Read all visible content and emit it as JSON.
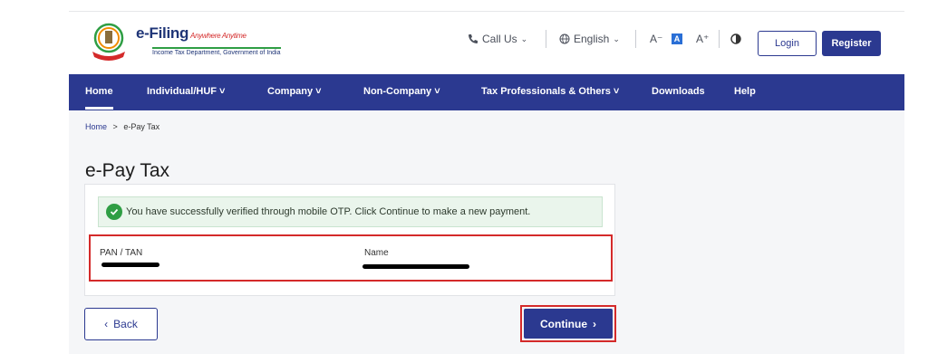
{
  "header": {
    "logo_title": "e-Filing",
    "logo_tagline": "Anywhere Anytime",
    "logo_subtitle": "Income Tax Department, Government of India",
    "call_us": "Call Us",
    "language": "English",
    "font_decrease": "A⁻",
    "font_default": "A",
    "font_increase": "A⁺",
    "login_label": "Login",
    "register_label": "Register"
  },
  "nav": {
    "items": [
      {
        "label": "Home"
      },
      {
        "label": "Individual/HUF ˅"
      },
      {
        "label": "Company ˅"
      },
      {
        "label": "Non-Company ˅"
      },
      {
        "label": "Tax Professionals & Others ˅"
      },
      {
        "label": "Downloads"
      },
      {
        "label": "Help"
      }
    ]
  },
  "breadcrumb": {
    "home": "Home",
    "separator": ">",
    "current": "e-Pay Tax"
  },
  "page": {
    "title": "e-Pay Tax",
    "alert_message": "You have successfully verified through mobile OTP. Click Continue to make a new payment.",
    "pan_label": "PAN / TAN",
    "name_label": "Name",
    "back_label": "Back",
    "continue_label": "Continue"
  },
  "colors": {
    "primary": "#2b3990",
    "success": "#2f9e44",
    "highlight": "#d42a2a"
  }
}
